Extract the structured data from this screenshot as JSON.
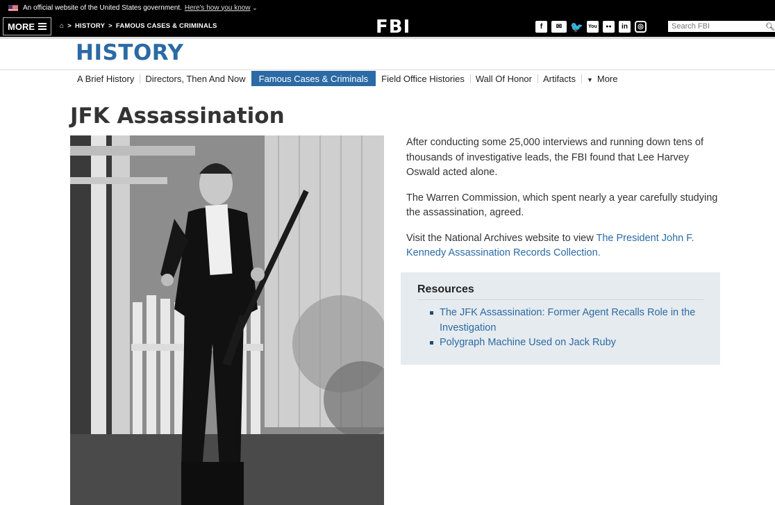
{
  "gov_banner": {
    "text": "An official website of the United States government.",
    "link": "Here's how you know"
  },
  "topnav": {
    "more_label": "MORE",
    "breadcrumb": [
      "HISTORY",
      "FAMOUS CASES & CRIMINALS"
    ],
    "logo": "FBI",
    "social": [
      "f",
      "✉",
      "🐦",
      "You",
      "●●",
      "in",
      "◎"
    ],
    "search_placeholder": "Search FBI"
  },
  "section": {
    "title": "HISTORY",
    "nav": [
      {
        "label": "A Brief History",
        "active": false
      },
      {
        "label": "Directors, Then And Now",
        "active": false
      },
      {
        "label": "Famous Cases & Criminals",
        "active": true
      },
      {
        "label": "Field Office Histories",
        "active": false
      },
      {
        "label": "Wall Of Honor",
        "active": false
      },
      {
        "label": "Artifacts",
        "active": false
      },
      {
        "label": "More",
        "active": false
      }
    ]
  },
  "article": {
    "title": "JFK Assassination",
    "para1": "After conducting some 25,000 interviews and running down tens of thousands of investigative leads, the FBI found that Lee Harvey Oswald acted alone.",
    "para2": "The Warren Commission, which spent nearly a year carefully studying the assassination, agreed.",
    "para3_text": "Visit the National Archives website to view ",
    "para3_link": "The President John F. Kennedy Assassination Records Collection."
  },
  "resources": {
    "heading": "Resources",
    "items": [
      "The JFK Assassination: Former Agent Recalls Role in the Investigation",
      "Polygraph Machine Used on Jack Ruby"
    ]
  },
  "colors": {
    "brand_blue": "#2b6aa4",
    "resources_bg": "#e6ebef",
    "topbar": "#000000"
  }
}
